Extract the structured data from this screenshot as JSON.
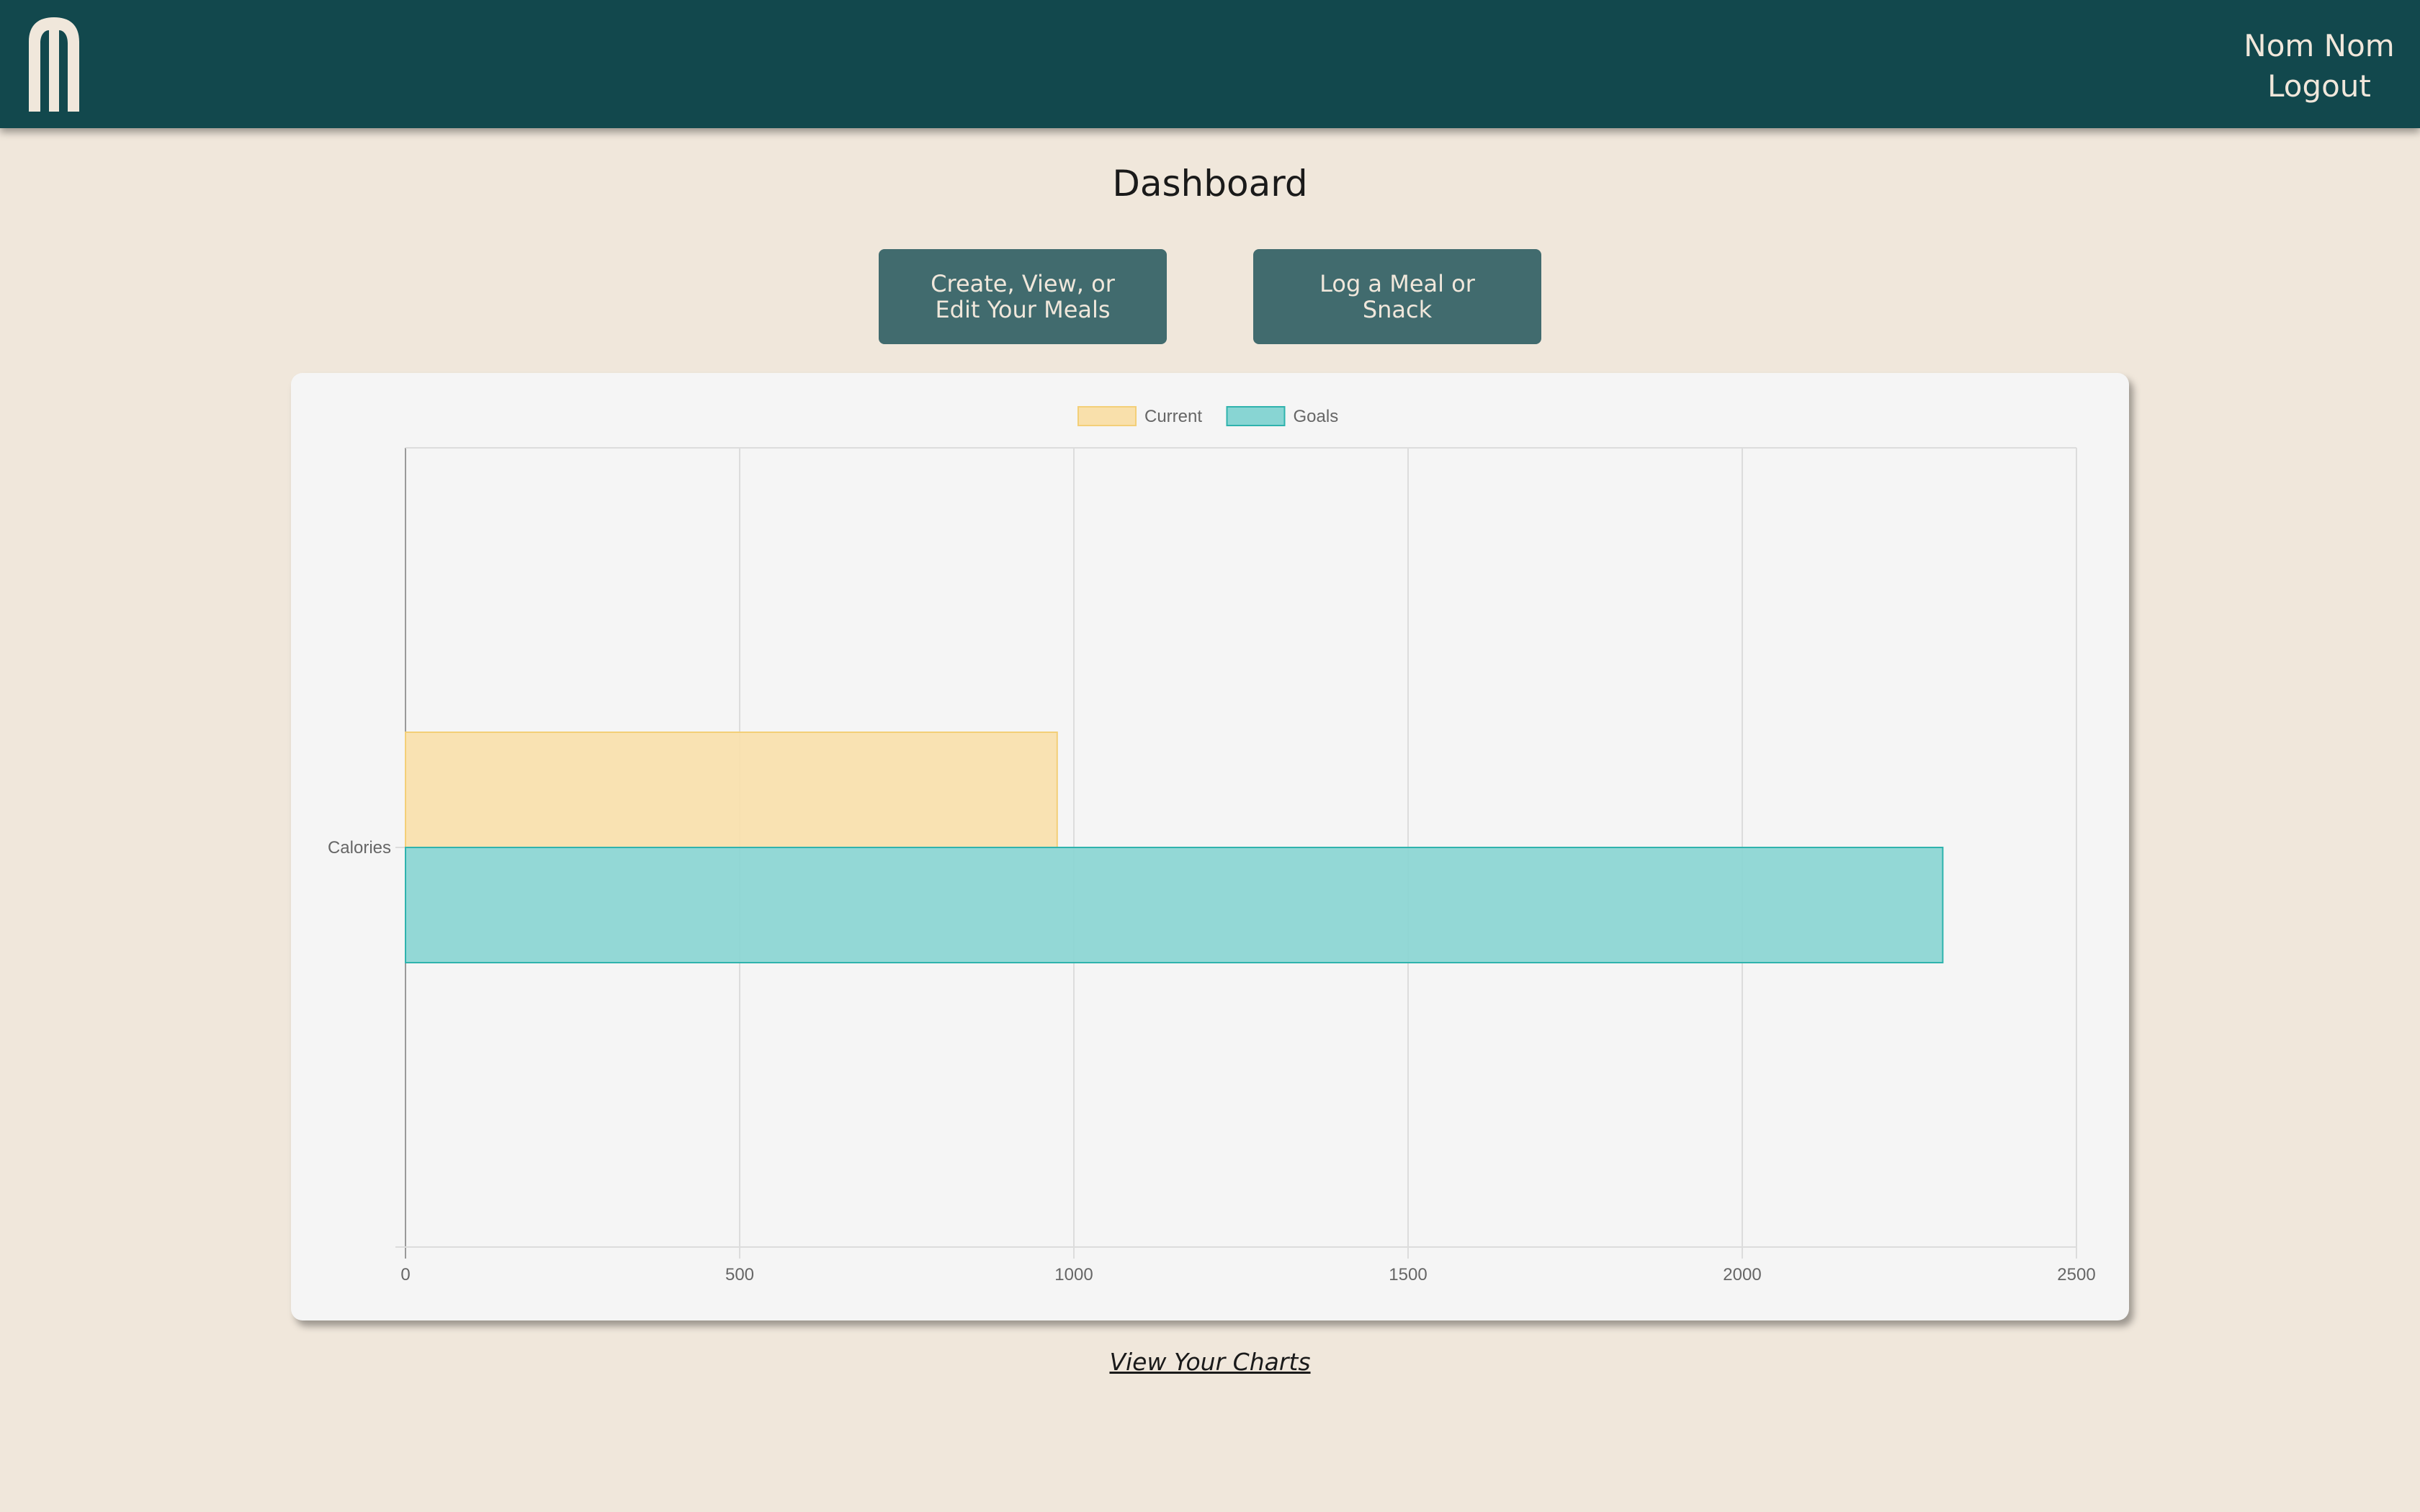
{
  "header": {
    "username": "Nom Nom",
    "logout_label": "Logout"
  },
  "page_title": "Dashboard",
  "actions": {
    "meals_label": "Create, View, or Edit Your Meals",
    "log_label": "Log a Meal or Snack"
  },
  "chart_data": {
    "type": "bar",
    "orientation": "horizontal",
    "categories": [
      "Calories"
    ],
    "series": [
      {
        "name": "Current",
        "values": [
          975
        ],
        "color": "#f9e0ab",
        "border": "#f3cf78"
      },
      {
        "name": "Goals",
        "values": [
          2300
        ],
        "color": "#88d5d3",
        "border": "#2fb3ad"
      }
    ],
    "xlim": [
      0,
      2500
    ],
    "x_ticks": [
      0,
      500,
      1000,
      1500,
      2000,
      2500
    ],
    "grid": true,
    "legend_position": "top"
  },
  "footer": {
    "charts_link": "View Your Charts"
  },
  "colors": {
    "header_bg": "#12484d",
    "page_bg": "#f0e7db",
    "button_bg": "#416b6e",
    "card_bg": "#f5f5f5"
  }
}
